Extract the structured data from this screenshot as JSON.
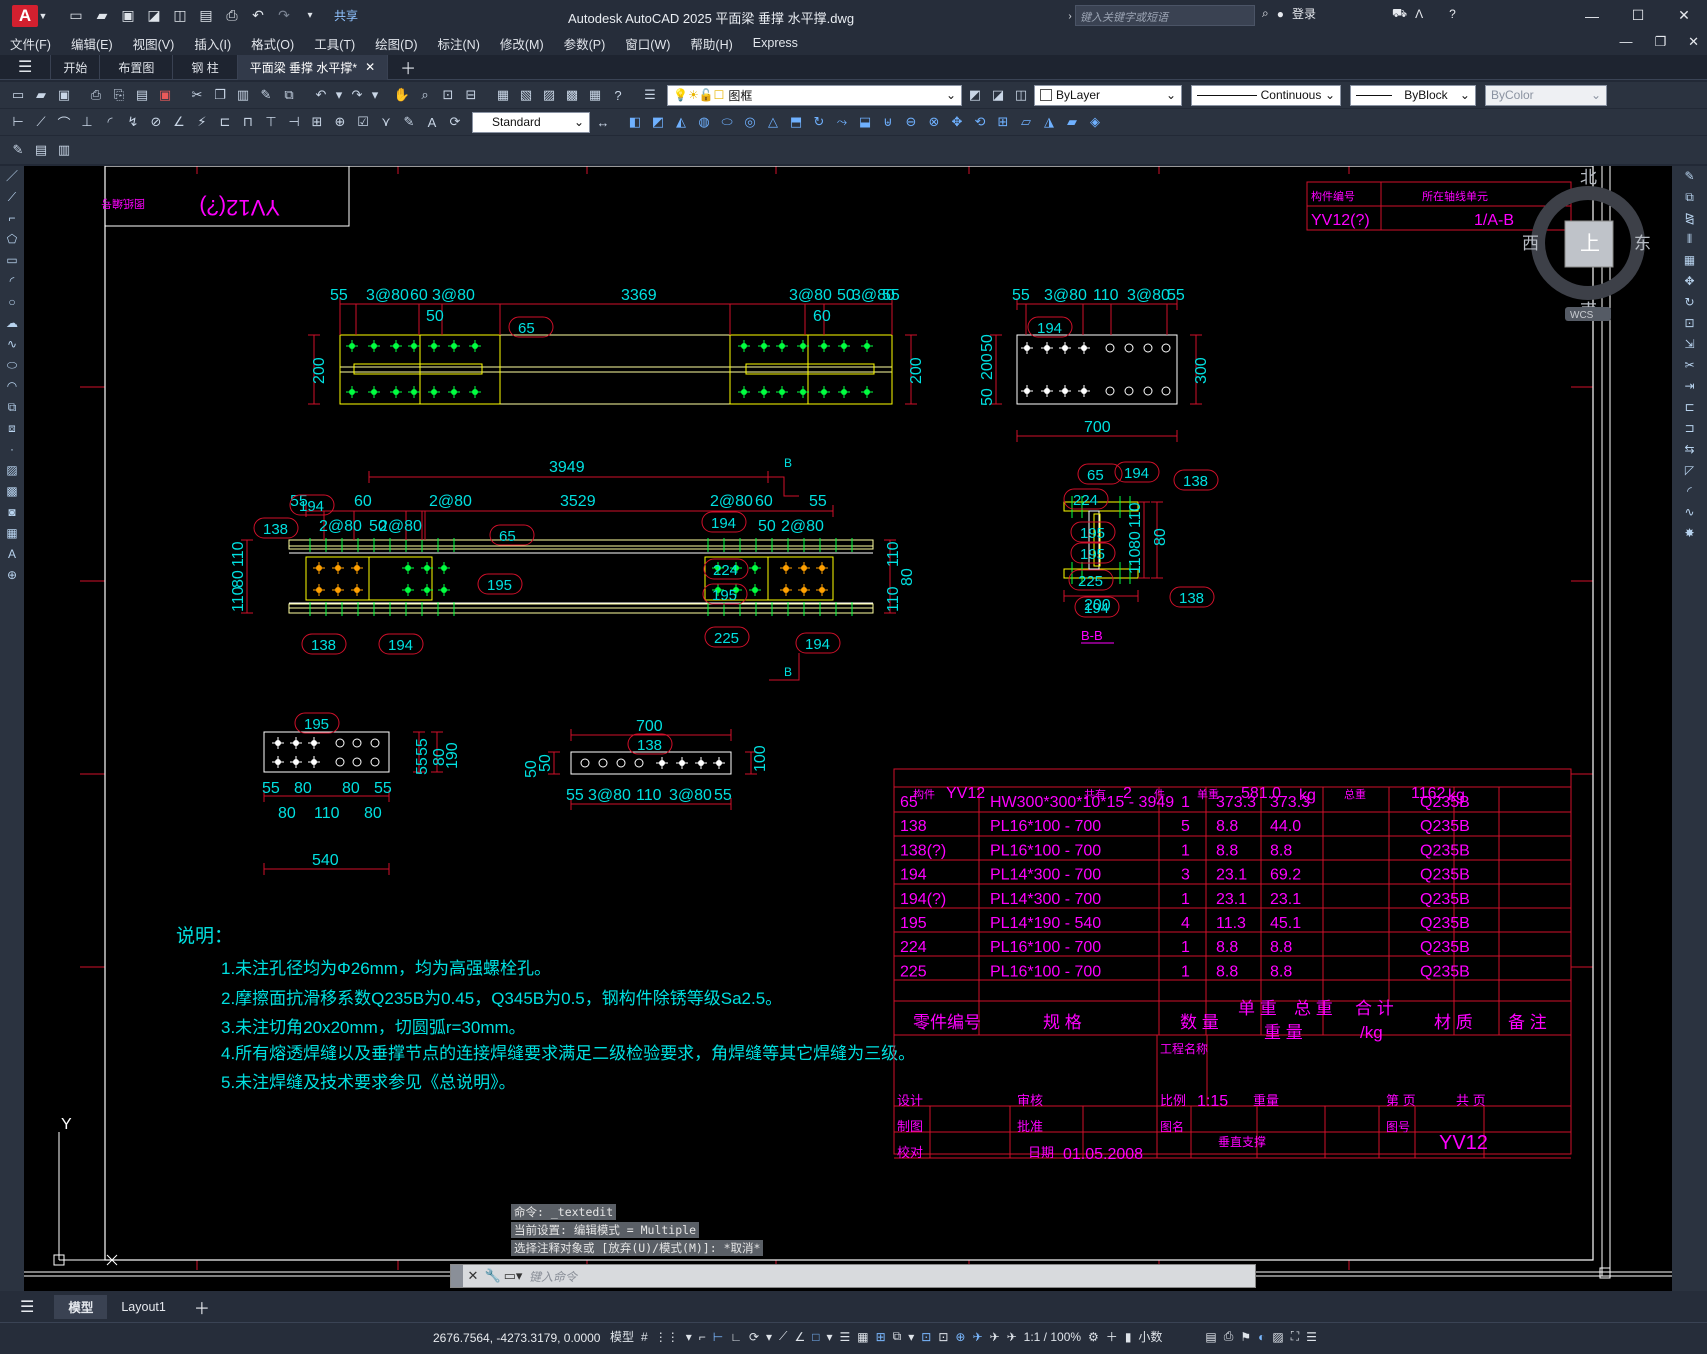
{
  "app": {
    "logo": "A",
    "title": "Autodesk AutoCAD 2025    平面梁 垂撑 水平撑.dwg",
    "share": "共享",
    "search_placeholder": "键入关键字或短语",
    "login": "登录"
  },
  "menu": [
    "文件(F)",
    "编辑(E)",
    "视图(V)",
    "插入(I)",
    "格式(O)",
    "工具(T)",
    "绘图(D)",
    "标注(N)",
    "修改(M)",
    "参数(P)",
    "窗口(W)",
    "帮助(H)",
    "Express"
  ],
  "tabs": [
    "开始",
    "布置图",
    "钢 柱",
    "平面梁 垂撑 水平撑*"
  ],
  "toolbar": {
    "layer": "图框",
    "color": "ByLayer",
    "linetype": "Continuous",
    "lineweight": "ByBlock",
    "plotstyle": "ByColor",
    "textstyle": "Standard"
  },
  "viewcube": {
    "north": "北",
    "south": "南",
    "east": "东",
    "west": "西",
    "top": "上",
    "wcs": "WCS"
  },
  "layout_tabs": [
    "模型",
    "Layout1"
  ],
  "status": {
    "coords": "2676.7564, -4273.3179, 0.0000",
    "model": "模型",
    "scale": "1:1 / 100%",
    "units": "小数"
  },
  "command": {
    "history": [
      "命令: _textedit",
      "当前设置: 编辑模式 = Multiple",
      "选择注释对象或 [放弃(U)/模式(M)]: *取消*"
    ],
    "placeholder": "键入命令"
  },
  "drawing": {
    "corner_stamp": "YV12(?)",
    "corner_stamp_label": "图纸编号",
    "header": {
      "label1": "构件编号",
      "label2": "所在轴线单元",
      "id": "YV12(?)",
      "axis": "1/A-B"
    },
    "top_dims": [
      "55",
      "3@80",
      "60",
      "3@80",
      "3369",
      "3@80",
      "50",
      "3@80",
      "55"
    ],
    "mid_dims": [
      "55",
      "60",
      "2@80",
      "50",
      "3529",
      "2@80",
      "60",
      "55"
    ],
    "overall_3949": "3949",
    "plate_dims": {
      "top": [
        "55",
        "3@80",
        "110",
        "3@80",
        "55"
      ],
      "w": "700",
      "h": "300",
      "sides": [
        "50",
        "200",
        "50"
      ]
    },
    "section_label": "B-B",
    "notes_title": "说明：",
    "notes": [
      "1.未注孔径均为Φ26mm，均为高强螺栓孔。",
      "2.摩擦面抗滑移系数Q235B为0.45，Q345B为0.5，钢构件除锈等级Sa2.5。",
      "3.未注切角20x20mm，切圆弧r=30mm。",
      "4.所有熔透焊缝以及垂撑节点的连接焊缝要求满足二级检验要求，角焊缝等其它焊缝为三级。",
      "5.未注焊缝及技术要求参见《总说明》。"
    ],
    "bom_header": {
      "c1": "构件",
      "id": "YV12",
      "c2": "共有",
      "count": "2",
      "c3": "件",
      "c4": "单重",
      "unit_w": "581.0",
      "kg": "kg",
      "c5": "总重",
      "total": "1162",
      "kg2": "kg"
    },
    "bom": [
      [
        "65",
        "HW300*300*10*15 - 3949",
        "1",
        "373.3",
        "373.3",
        "Q235B"
      ],
      [
        "138",
        "PL16*100 - 700",
        "5",
        "8.8",
        "44.0",
        "Q235B"
      ],
      [
        "138(?)",
        "PL16*100 - 700",
        "1",
        "8.8",
        "8.8",
        "Q235B"
      ],
      [
        "194",
        "PL14*300 - 700",
        "3",
        "23.1",
        "69.2",
        "Q235B"
      ],
      [
        "194(?)",
        "PL14*300 - 700",
        "1",
        "23.1",
        "23.1",
        "Q235B"
      ],
      [
        "195",
        "PL14*190 - 540",
        "4",
        "11.3",
        "45.1",
        "Q235B"
      ],
      [
        "224",
        "PL16*100 - 700",
        "1",
        "8.8",
        "8.8",
        "Q235B"
      ],
      [
        "225",
        "PL16*100 - 700",
        "1",
        "8.8",
        "8.8",
        "Q235B"
      ]
    ],
    "bom_cols": {
      "part": "零件编号",
      "spec": "规 格",
      "qty": "数 量",
      "unit": "单 重",
      "total": "总 重",
      "sum": "合 计",
      "weight": "重 量",
      "perkg": "/kg",
      "mat": "材 质",
      "remark": "备 注"
    },
    "title_block": {
      "project": "工程名称",
      "design": "设计",
      "review": "审核",
      "scale_l": "比例",
      "scale": "1:15",
      "weight": "重量",
      "page": "第  页",
      "pages": "共  页",
      "draw": "制图",
      "approve": "批准",
      "drawing_name_l": "图名",
      "drawing_name": "垂直支撑",
      "drawing_no_l": "图号",
      "drawing_no": "YV12",
      "check": "校对",
      "date_l": "日期",
      "date": "01.05.2008"
    }
  }
}
